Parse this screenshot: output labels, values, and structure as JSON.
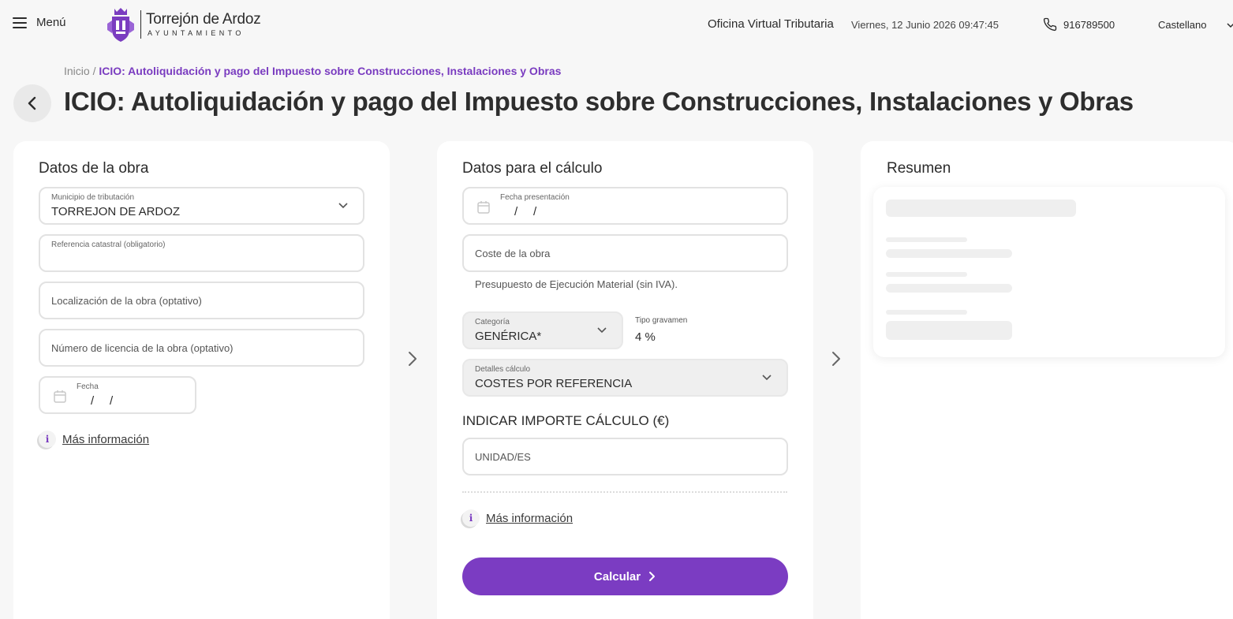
{
  "header": {
    "menu_label": "Menú",
    "logo_line1": "Torrejón de Ardoz",
    "logo_line2": "AYUNTAMIENTO",
    "office": "Oficina Virtual Tributaria",
    "datetime": "Viernes, 12 Junio 2026 09:47:45",
    "phone": "916789500",
    "language": "Castellano"
  },
  "breadcrumb": {
    "home": "Inicio",
    "separator": "/",
    "current": "ICIO: Autoliquidación y pago del Impuesto sobre Construcciones, Instalaciones y Obras"
  },
  "page_title": "ICIO: Autoliquidación y pago del Impuesto sobre Construcciones, Instalaciones y Obras",
  "obra": {
    "title": "Datos de la obra",
    "municipio_label": "Municipio de tributación",
    "municipio_value": "TORREJON DE ARDOZ",
    "referencia_label": "Referencia catastral (obligatorio)",
    "localizacion_placeholder": "Localización de la obra (optativo)",
    "licencia_placeholder": "Número de licencia de la obra (optativo)",
    "fecha_label": "Fecha",
    "date_slash": "/",
    "info_link": "Más información"
  },
  "calculo": {
    "title": "Datos para el cálculo",
    "fecha_label": "Fecha presentación",
    "coste_placeholder": "Coste de la obra",
    "coste_hint": "Presupuesto de Ejecución Material (sin IVA).",
    "categoria_label": "Categoría",
    "categoria_value": "GENÉRICA*",
    "tipo_label": "Tipo gravamen",
    "tipo_value": "4 %",
    "detalles_label": "Detalles cálculo",
    "detalles_value": "COSTES POR REFERENCIA",
    "indicar_label": "INDICAR IMPORTE CÁLCULO (€)",
    "unidades_placeholder": "UNIDAD/ES",
    "info_link": "Más información",
    "calc_button": "Calcular"
  },
  "resumen": {
    "title": "Resumen"
  },
  "colors": {
    "accent": "#7b3cc2",
    "breadcrumb_current": "#7a3cc0"
  }
}
